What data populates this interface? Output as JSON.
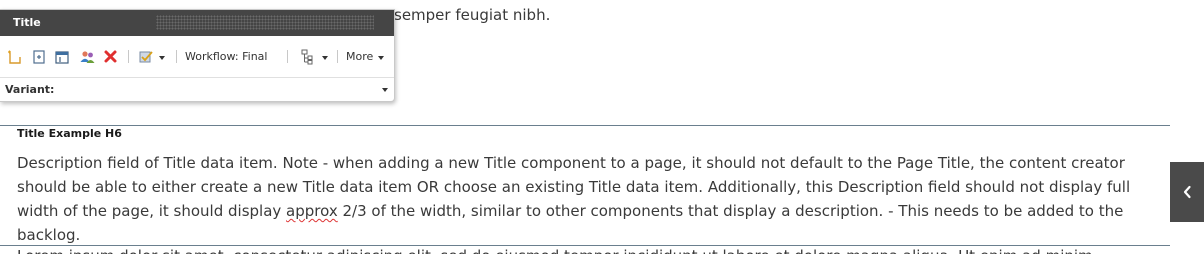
{
  "content": {
    "top_text": "semper feugiat nibh.",
    "heading": "Title Example H6",
    "description_part1": "Description field of Title data item. Note - when adding a new Title component to a page, it should not default to the Page Title, the content creator should be able to either create a new Title data item OR choose an existing Title data item. Additionally, this Description field should not display full width of the page, it should display ",
    "description_spell": "approx",
    "description_part2": " 2/3 of the width, similar to other components that display a description. - This needs to be added to the backlog.",
    "bottom_text_clipped": "Lorem ipsum dolor sit amet, consectetur adipiscing elit, sed do eiusmod tempor incididunt ut labore et dolore magna aliqua. Ut enim ad minim"
  },
  "panel": {
    "title": "Title",
    "toolbar": {
      "icons": [
        "new-item-icon",
        "insert-item-icon",
        "edit-item-icon",
        "users-icon",
        "delete-icon",
        "validate-icon"
      ],
      "workflow_label": "Workflow: Final",
      "more_label": "More"
    },
    "variant_label": "Variant:",
    "variant_value": ""
  },
  "colors": {
    "panel_header": "#454545",
    "delete_icon": "#e03030",
    "text": "#3a3a3a",
    "side_tab": "#4a4a4a",
    "divider": "#6a7f8e"
  }
}
